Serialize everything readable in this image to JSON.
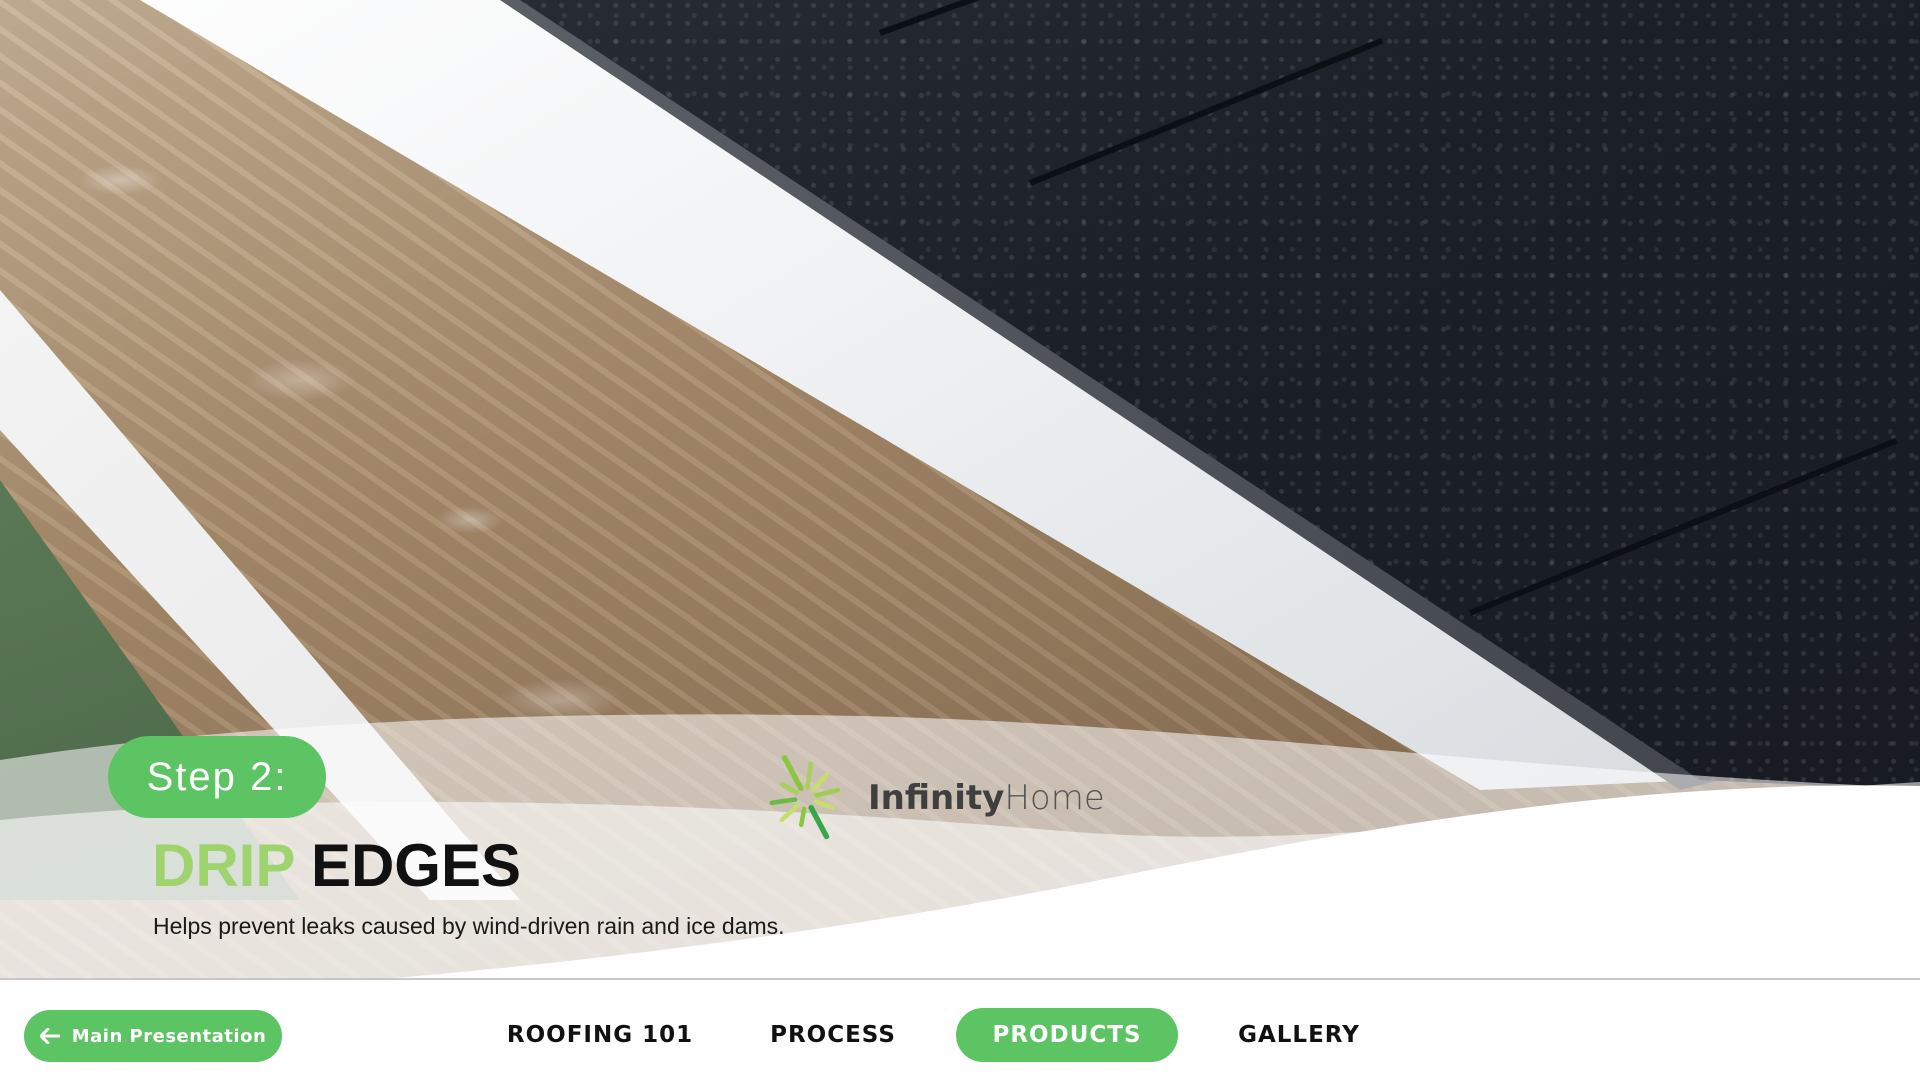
{
  "slide": {
    "step_label": "Step 2:",
    "title_accent": "DRIP",
    "title_main": "EDGES",
    "subtitle": "Helps prevent leaks caused by wind-driven rain and ice dams."
  },
  "logo": {
    "name_part1": "Infinity",
    "name_part2": "Home"
  },
  "nav": {
    "back_button": "Main Presentation",
    "back_icon": "arrow-left-icon",
    "items": [
      {
        "label": "ROOFING 101",
        "active": false
      },
      {
        "label": "PROCESS",
        "active": false
      },
      {
        "label": "PRODUCTS",
        "active": true
      },
      {
        "label": "GALLERY",
        "active": false
      }
    ]
  },
  "colors": {
    "accent_green": "#5cc463",
    "title_green": "#9ed36e",
    "text_dark": "#111111"
  },
  "background_image": "roof-drip-edge-rain-photo"
}
